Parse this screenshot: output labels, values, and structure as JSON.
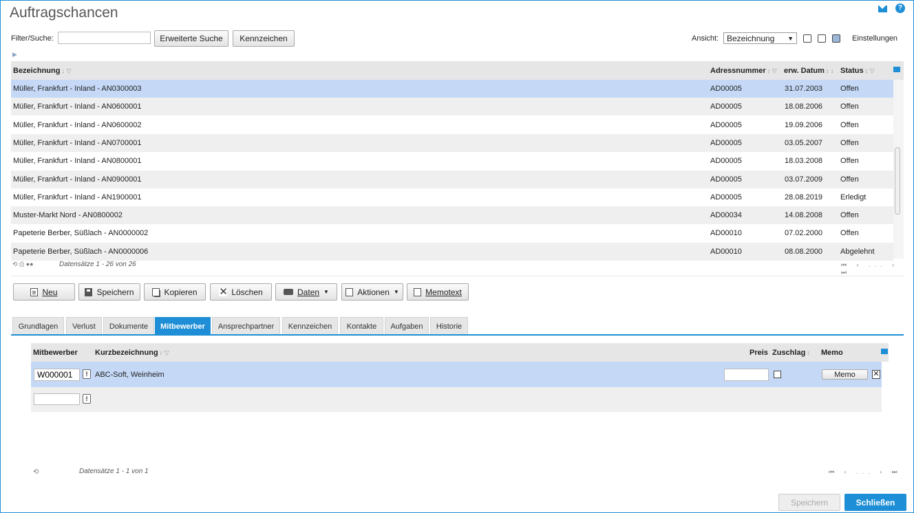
{
  "header": {
    "title": "Auftragschancen"
  },
  "filter": {
    "label": "Filter/Suche:",
    "value": "",
    "advanced_search": "Erweiterte Suche",
    "tags": "Kennzeichen",
    "view_label": "Ansicht:",
    "view_value": "Bezeichnung",
    "settings": "Einstellungen"
  },
  "grid": {
    "columns": [
      "Bezeichnung",
      "Adressnummer",
      "erw. Datum",
      "Status"
    ],
    "rows": [
      {
        "name": "Müller, Frankfurt - Inland - AN0300003",
        "addr": "AD00005",
        "date": "31.07.2003",
        "status": "Offen"
      },
      {
        "name": "Müller, Frankfurt - Inland - AN0600001",
        "addr": "AD00005",
        "date": "18.08.2006",
        "status": "Offen"
      },
      {
        "name": "Müller, Frankfurt - Inland - AN0600002",
        "addr": "AD00005",
        "date": "19.09.2006",
        "status": "Offen"
      },
      {
        "name": "Müller, Frankfurt - Inland - AN0700001",
        "addr": "AD00005",
        "date": "03.05.2007",
        "status": "Offen"
      },
      {
        "name": "Müller, Frankfurt - Inland - AN0800001",
        "addr": "AD00005",
        "date": "18.03.2008",
        "status": "Offen"
      },
      {
        "name": "Müller, Frankfurt - Inland - AN0900001",
        "addr": "AD00005",
        "date": "03.07.2009",
        "status": "Offen"
      },
      {
        "name": "Müller, Frankfurt - Inland - AN1900001",
        "addr": "AD00005",
        "date": "28.08.2019",
        "status": "Erledigt"
      },
      {
        "name": "Muster-Markt Nord - AN0800002",
        "addr": "AD00034",
        "date": "14.08.2008",
        "status": "Offen"
      },
      {
        "name": "Papeterie Berber, Süßlach - AN0000002",
        "addr": "AD00010",
        "date": "07.02.2000",
        "status": "Offen"
      },
      {
        "name": "Papeterie Berber, Süßlach - AN0000006",
        "addr": "AD00010",
        "date": "08.08.2000",
        "status": "Abgelehnt"
      }
    ],
    "records": "Datensätze 1 - 26 von 26",
    "pager": "...",
    "selected_index": 0
  },
  "toolbar": {
    "new": "Neu",
    "save": "Speichern",
    "copy": "Kopieren",
    "delete": "Löschen",
    "data": "Daten",
    "actions": "Aktionen",
    "memo": "Memotext"
  },
  "tabs": [
    "Grundlagen",
    "Verlust",
    "Dokumente",
    "Mitbewerber",
    "Ansprechpartner",
    "Kennzeichen",
    "Kontakte",
    "Aufgaben",
    "Historie"
  ],
  "active_tab": "Mitbewerber",
  "competitors": {
    "columns": {
      "competitor": "Mitbewerber",
      "short": "Kurzbezeichnung",
      "price": "Preis",
      "award": "Zuschlag",
      "memo": "Memo"
    },
    "row": {
      "id": "W000001",
      "short": "ABC-Soft, Weinheim",
      "price": "",
      "award": false,
      "memo_button": "Memo"
    },
    "records": "Datensätze 1 - 1 von 1",
    "pager": "..."
  },
  "footer": {
    "save": "Speichern",
    "close": "Schließen"
  },
  "colors": {
    "accent": "#1e8fd6",
    "selection": "#c5d9f7"
  }
}
